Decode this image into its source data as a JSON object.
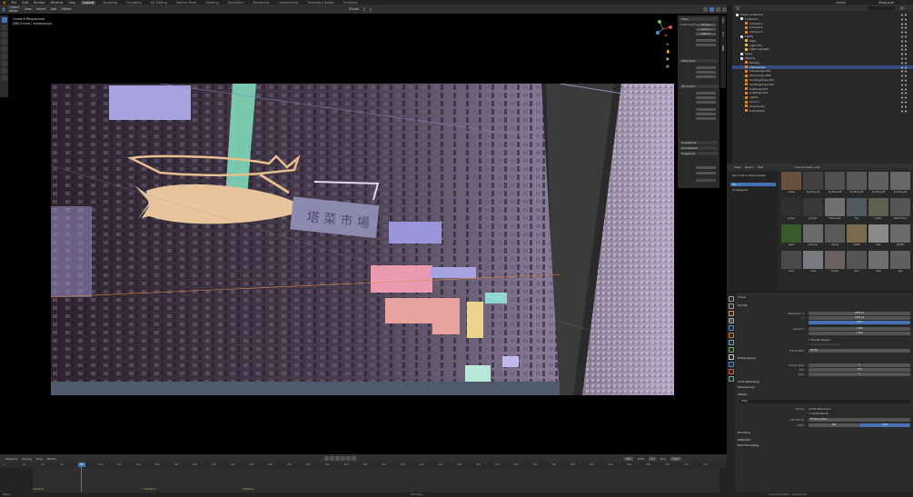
{
  "app": {
    "name": "Blender"
  },
  "topbar": {
    "menus": [
      "File",
      "Edit",
      "Render",
      "Window",
      "Help"
    ],
    "workspaces": [
      "Layout",
      "Modeling",
      "Sculpting",
      "UV Editing",
      "Texture Paint",
      "Shading",
      "Animation",
      "Rendering",
      "Compositing",
      "Geometry Nodes",
      "Scripting"
    ],
    "active_workspace": "Layout",
    "scene": "Scene",
    "view_layer": "ViewLayer"
  },
  "viewport": {
    "header_menus": [
      "Object Mode",
      "View",
      "Select",
      "Add",
      "Object"
    ],
    "orientation": "Global",
    "camera_title": "Camera Perspective",
    "camera_subtitle": "(86) Scene | subwaysign",
    "sign_text": "塔 菜 市 場"
  },
  "npanel": {
    "tabs": [
      "Item",
      "Tool",
      "View"
    ],
    "sections": [
      "View",
      "View Lock",
      "3D Cursor",
      "Collections",
      "Annotations",
      "Viewpoint"
    ],
    "fields": {
      "focal_length": "50 mm",
      "clip_start": "0.01 m",
      "clip_end": "1000 m"
    }
  },
  "outliner": {
    "title": "Scene Collection",
    "rows": [
      {
        "name": "Scene Collection",
        "indent": 0,
        "color": "#e0e0e0",
        "selected": false
      },
      {
        "name": "Collection",
        "indent": 1,
        "color": "#e0e0e0",
        "selected": false
      },
      {
        "name": "Camera.1",
        "indent": 2,
        "color": "#e08a2a",
        "selected": false
      },
      {
        "name": "Camera.2",
        "indent": 2,
        "color": "#e08a2a",
        "selected": false
      },
      {
        "name": "Camera.3",
        "indent": 2,
        "color": "#e08a2a",
        "selected": false
      },
      {
        "name": "Lights",
        "indent": 1,
        "color": "#e0e0e0",
        "selected": false
      },
      {
        "name": "Light",
        "indent": 2,
        "color": "#e0c050",
        "selected": false
      },
      {
        "name": "Light.001",
        "indent": 2,
        "color": "#e0c050",
        "selected": false
      },
      {
        "name": "Light.highlight",
        "indent": 2,
        "color": "#e0c050",
        "selected": false
      },
      {
        "name": "Signs",
        "indent": 1,
        "color": "#e0e0e0",
        "selected": false
      },
      {
        "name": "Objects",
        "indent": 1,
        "color": "#e0e0e0",
        "selected": false
      },
      {
        "name": "fishsign",
        "indent": 2,
        "color": "#e08a2a",
        "selected": false
      },
      {
        "name": "subwaysign",
        "indent": 2,
        "color": "#e08a2a",
        "selected": true
      },
      {
        "name": "bannersign.001",
        "indent": 2,
        "color": "#e08a2a",
        "selected": false
      },
      {
        "name": "bannersign.002",
        "indent": 2,
        "color": "#e08a2a",
        "selected": false
      },
      {
        "name": "buildingstrips.001",
        "indent": 2,
        "color": "#e08a2a",
        "selected": false
      },
      {
        "name": "buildingstrips.002",
        "indent": 2,
        "color": "#e08a2a",
        "selected": false
      },
      {
        "name": "buildings.001",
        "indent": 2,
        "color": "#e08a2a",
        "selected": false
      },
      {
        "name": "buildings.002",
        "indent": 2,
        "color": "#e08a2a",
        "selected": false
      },
      {
        "name": "cables",
        "indent": 2,
        "color": "#e08a2a",
        "selected": false
      },
      {
        "name": "ground",
        "indent": 2,
        "color": "#e08a2a",
        "selected": false
      },
      {
        "name": "propcluster",
        "indent": 2,
        "color": "#e08a2a",
        "selected": false
      },
      {
        "name": "trainstation",
        "indent": 2,
        "color": "#e08a2a",
        "selected": false
      }
    ]
  },
  "assets": {
    "header_menus": [
      "View",
      "Select",
      "Edit"
    ],
    "library": "Import Asset: Link",
    "categories": [
      "My Custom Asset Assets",
      "All",
      "Unassigned"
    ],
    "tiles": [
      {
        "label": "crates",
        "color": "#6a5040"
      },
      {
        "label": "building.01",
        "color": "#404040"
      },
      {
        "label": "building.02",
        "color": "#505050"
      },
      {
        "label": "building.03",
        "color": "#585858"
      },
      {
        "label": "building.04",
        "color": "#606060"
      },
      {
        "label": "building.05",
        "color": "#686868"
      },
      {
        "label": "acunit",
        "color": "#303030"
      },
      {
        "label": "grinder",
        "color": "#383838"
      },
      {
        "label": "doorframe",
        "color": "#707070"
      },
      {
        "label": "fan",
        "color": "#505860"
      },
      {
        "label": "pipes",
        "color": "#606050"
      },
      {
        "label": "electricbox",
        "color": "#555555"
      },
      {
        "label": "plant",
        "color": "#3a5a2a"
      },
      {
        "label": "shelves",
        "color": "#6a6a6a"
      },
      {
        "label": "railing",
        "color": "#5a5a5a"
      },
      {
        "label": "pallet",
        "color": "#7a6a50"
      },
      {
        "label": "sign",
        "color": "#8a8a8a"
      },
      {
        "label": "ladder",
        "color": "#6a6a6a"
      },
      {
        "label": "vent",
        "color": "#4a4a4a"
      },
      {
        "label": "cube",
        "color": "#7a7a80"
      },
      {
        "label": "boxes",
        "color": "#6a6060"
      },
      {
        "label": "wire",
        "color": "#555555"
      },
      {
        "label": "tank",
        "color": "#707070"
      },
      {
        "label": "gas",
        "color": "#606060"
      }
    ]
  },
  "properties": {
    "active_tab": "Output",
    "tab_colors": [
      "#a0a0a0",
      "#a0a0a0",
      "#e0a060",
      "#a0a0a0",
      "#4a90d0",
      "#d07040",
      "#70a0d0",
      "#60b060",
      "#d0d0d0",
      "#4a90d0",
      "#e05050",
      "#60b0b0"
    ],
    "scene": "Scene",
    "sections": {
      "format": "Format",
      "frame_range": "Frame Range",
      "time_stretching": "Time Stretching",
      "stereoscopy": "Stereoscopy",
      "output": "Output",
      "encoding": "Encoding",
      "metadata": "Metadata",
      "post_processing": "Post Processing"
    },
    "fields": {
      "resolution_x_label": "Resolution X",
      "resolution_x": "1920 px",
      "resolution_y_label": "Y",
      "resolution_y": "1080 px",
      "percent": "100%",
      "aspect_x_label": "Aspect X",
      "aspect_x": "1.000",
      "aspect_y": "1.000",
      "render_region": "Render Region",
      "crop": "Crop to Render Region",
      "frame_rate_label": "Frame Rate",
      "frame_rate": "24 fps",
      "frame_start_label": "Frame Start",
      "frame_start": "1",
      "frame_end_label": "End",
      "frame_end": "250",
      "frame_step_label": "Step",
      "frame_step": "1",
      "output_path": "/tmp/",
      "saving_label": "Saving",
      "file_extensions": "File Extensions",
      "cache_result": "Cache Result",
      "file_format_label": "File Format",
      "file_format": "FFmpeg Video",
      "color_label": "Color",
      "color_bw": "BW",
      "color_rgb": "RGB"
    }
  },
  "timeline": {
    "header_menus": [
      "Playback",
      "Keying",
      "View",
      "Marker"
    ],
    "current_frame": "86",
    "start_label": "Start",
    "start": "1",
    "end_label": "End",
    "end": "250",
    "ticks": [
      "0",
      "20",
      "40",
      "60",
      "80",
      "100",
      "120",
      "140",
      "160",
      "180",
      "200",
      "220",
      "240",
      "260",
      "280",
      "300",
      "320",
      "340",
      "360",
      "380",
      "400",
      "420",
      "440",
      "460",
      "480",
      "500",
      "520",
      "540",
      "560",
      "580",
      "600",
      "620",
      "640",
      "660",
      "680",
      "700",
      "720",
      "740"
    ],
    "markers": [
      {
        "label": "camera.1",
        "frame": 0
      },
      {
        "label": "camera.2",
        "frame": 175
      },
      {
        "label": "camera.3",
        "frame": 330
      }
    ]
  },
  "statusbar": {
    "left": "Select",
    "center": "Pan View",
    "right": "Scene Collection | subwaysign"
  }
}
